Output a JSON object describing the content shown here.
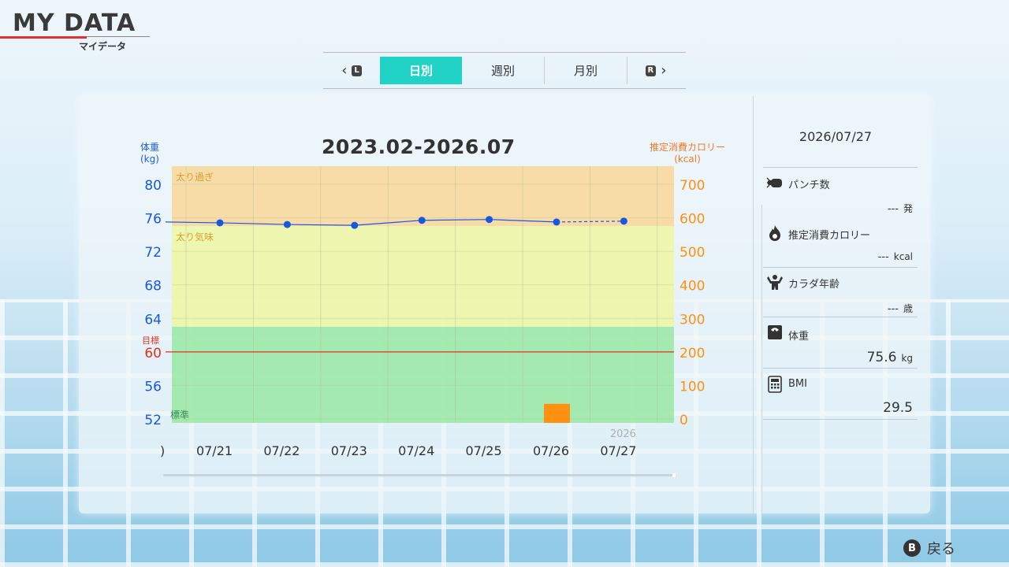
{
  "header": {
    "title": "MY DATA",
    "subtitle": "マイデータ"
  },
  "tabs": {
    "prev_badge": "L",
    "next_badge": "R",
    "items": [
      {
        "label": "日別",
        "active": true
      },
      {
        "label": "週別",
        "active": false
      },
      {
        "label": "月別",
        "active": false
      }
    ]
  },
  "chart_data": {
    "type": "line",
    "title": "2023.02-2026.07",
    "left_axis": {
      "label_line1": "体重",
      "label_line2": "(kg)",
      "ticks": [
        80,
        76,
        72,
        68,
        64,
        60,
        56,
        52
      ],
      "range": [
        52,
        80
      ]
    },
    "right_axis": {
      "label_line1": "推定消費カロリー",
      "label_line2": "(kcal)",
      "ticks": [
        700,
        600,
        500,
        400,
        300,
        200,
        100,
        0
      ],
      "range": [
        0,
        700
      ]
    },
    "zones": [
      {
        "label": "太り過ぎ",
        "from": 75,
        "to": 80,
        "color": "#f8d9a0"
      },
      {
        "label": "太り気味",
        "from": 63,
        "to": 75,
        "color": "#eef6a8"
      },
      {
        "label": "標準",
        "from": 52,
        "to": 63,
        "color": "#9ee8a8"
      }
    ],
    "goal": {
      "label": "目標",
      "value": 60
    },
    "categories": [
      "07/21",
      "07/22",
      "07/23",
      "07/24",
      "07/25",
      "07/26",
      "07/27"
    ],
    "partial_left_label": ")",
    "year_label": "2026",
    "series": [
      {
        "values": [
          75.4,
          75.2,
          75.1,
          75.7,
          75.8,
          75.5,
          75.6
        ]
      }
    ],
    "weight_start": 75.5,
    "calorie_bars": [
      {
        "category": "07/26",
        "value": 45
      }
    ],
    "colors": {
      "weight": "#1858e0",
      "calorie": "#ff9010",
      "goal": "#e03020"
    }
  },
  "side": {
    "date": "2026/07/27",
    "items": [
      {
        "label": "パンチ数",
        "value": "---",
        "unit": "発",
        "icon": "boxing-glove-icon"
      },
      {
        "label": "推定消費カロリー",
        "value": "---",
        "unit": "kcal",
        "icon": "flame-icon"
      },
      {
        "label": "カラダ年齢",
        "value": "---",
        "unit": "歳",
        "icon": "muscle-figure-icon"
      },
      {
        "label": "体重",
        "value": "75.6",
        "unit": "kg",
        "icon": "scale-icon"
      },
      {
        "label": "BMI",
        "value": "29.5",
        "unit": "",
        "icon": "calculator-icon"
      }
    ]
  },
  "footer": {
    "back_badge": "B",
    "back_label": "戻る"
  }
}
